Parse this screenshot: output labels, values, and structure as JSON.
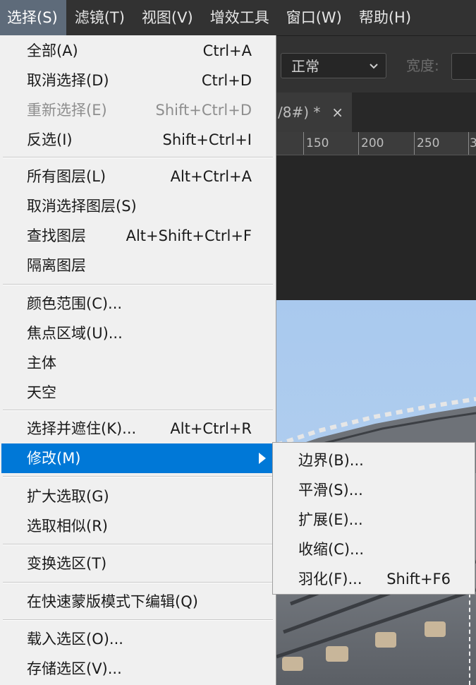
{
  "menubar": {
    "items": [
      "选择(S)",
      "滤镜(T)",
      "视图(V)",
      "增效工具",
      "窗口(W)",
      "帮助(H)"
    ]
  },
  "options_bar": {
    "mode_value": "正常",
    "width_label": "宽度:"
  },
  "document_tab": {
    "title": "/8#) *",
    "close": "×"
  },
  "ruler": {
    "labels": [
      "150",
      "200",
      "250",
      "3"
    ]
  },
  "select_menu": {
    "items": [
      {
        "label": "全部(A)",
        "shortcut": "Ctrl+A"
      },
      {
        "label": "取消选择(D)",
        "shortcut": "Ctrl+D"
      },
      {
        "label": "重新选择(E)",
        "shortcut": "Shift+Ctrl+D",
        "disabled": true
      },
      {
        "label": "反选(I)",
        "shortcut": "Shift+Ctrl+I"
      },
      {
        "label": "所有图层(L)",
        "shortcut": "Alt+Ctrl+A"
      },
      {
        "label": "取消选择图层(S)",
        "shortcut": ""
      },
      {
        "label": "查找图层",
        "shortcut": "Alt+Shift+Ctrl+F"
      },
      {
        "label": "隔离图层",
        "shortcut": ""
      },
      {
        "label": "颜色范围(C)...",
        "shortcut": ""
      },
      {
        "label": "焦点区域(U)...",
        "shortcut": ""
      },
      {
        "label": "主体",
        "shortcut": ""
      },
      {
        "label": "天空",
        "shortcut": ""
      },
      {
        "label": "选择并遮住(K)...",
        "shortcut": "Alt+Ctrl+R"
      },
      {
        "label": "修改(M)",
        "shortcut": "",
        "highlighted": true
      },
      {
        "label": "扩大选取(G)",
        "shortcut": ""
      },
      {
        "label": "选取相似(R)",
        "shortcut": ""
      },
      {
        "label": "变换选区(T)",
        "shortcut": ""
      },
      {
        "label": "在快速蒙版模式下编辑(Q)",
        "shortcut": ""
      },
      {
        "label": "载入选区(O)...",
        "shortcut": ""
      },
      {
        "label": "存储选区(V)...",
        "shortcut": ""
      }
    ]
  },
  "modify_submenu": {
    "items": [
      {
        "label": "边界(B)...",
        "shortcut": ""
      },
      {
        "label": "平滑(S)...",
        "shortcut": ""
      },
      {
        "label": "扩展(E)...",
        "shortcut": ""
      },
      {
        "label": "收缩(C)...",
        "shortcut": ""
      },
      {
        "label": "羽化(F)...",
        "shortcut": "Shift+F6"
      }
    ]
  },
  "colors": {
    "menu_bg": "#f0f0f0",
    "highlight": "#0078d7",
    "menubar_bg": "#323232",
    "menubar_active": "#5e6b7a"
  }
}
